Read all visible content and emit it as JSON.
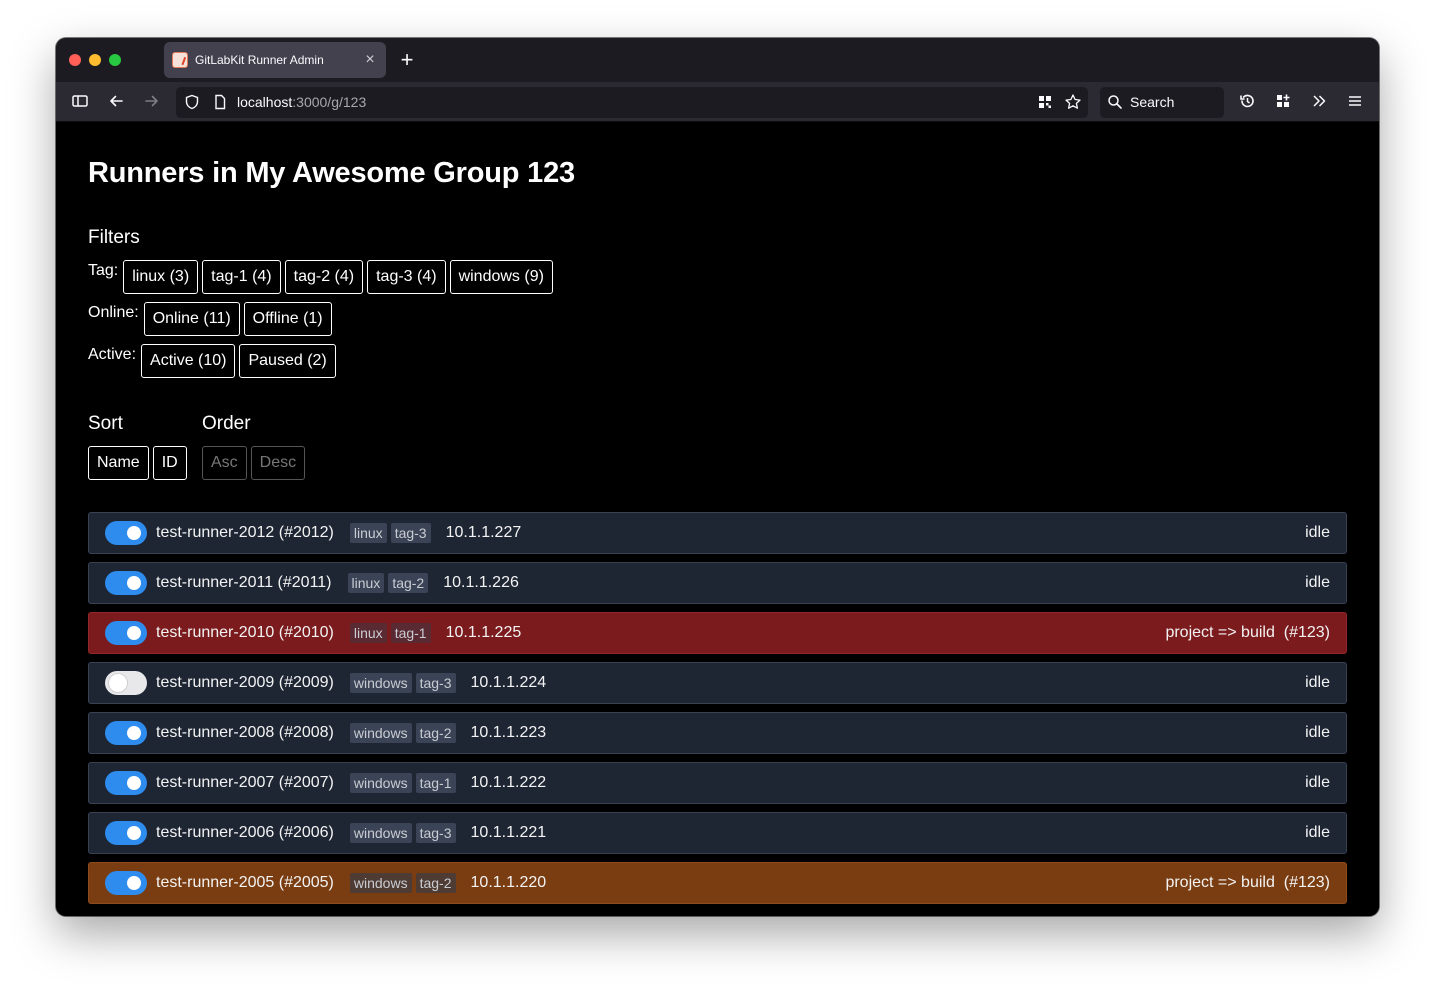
{
  "browser": {
    "tab_title": "GitLabKit Runner Admin",
    "new_tab": "+",
    "close": "×",
    "url_host": "localhost",
    "url_rest": ":3000/g/123",
    "search_placeholder": "Search"
  },
  "page": {
    "title": "Runners in My Awesome Group 123",
    "filters_title": "Filters",
    "filters": [
      {
        "label": "Tag:",
        "chips": [
          "linux (3)",
          "tag-1 (4)",
          "tag-2 (4)",
          "tag-3 (4)",
          "windows (9)"
        ]
      },
      {
        "label": "Online:",
        "chips": [
          "Online (11)",
          "Offline (1)"
        ]
      },
      {
        "label": "Active:",
        "chips": [
          "Active (10)",
          "Paused (2)"
        ]
      }
    ],
    "sort_title": "Sort",
    "sort_options": [
      "Name",
      "ID"
    ],
    "order_title": "Order",
    "order_options": [
      "Asc",
      "Desc"
    ]
  },
  "runners": [
    {
      "name": "test-runner-2012 (#2012)",
      "tags": [
        "linux",
        "tag-3"
      ],
      "ip": "10.1.1.227",
      "status": "idle",
      "active": true,
      "state": "idle"
    },
    {
      "name": "test-runner-2011 (#2011)",
      "tags": [
        "linux",
        "tag-2"
      ],
      "ip": "10.1.1.226",
      "status": "idle",
      "active": true,
      "state": "idle"
    },
    {
      "name": "test-runner-2010 (#2010)",
      "tags": [
        "linux",
        "tag-1"
      ],
      "ip": "10.1.1.225",
      "status": "project => build  (#123)",
      "active": true,
      "state": "busy-red"
    },
    {
      "name": "test-runner-2009 (#2009)",
      "tags": [
        "windows",
        "tag-3"
      ],
      "ip": "10.1.1.224",
      "status": "idle",
      "active": false,
      "state": "idle"
    },
    {
      "name": "test-runner-2008 (#2008)",
      "tags": [
        "windows",
        "tag-2"
      ],
      "ip": "10.1.1.223",
      "status": "idle",
      "active": true,
      "state": "idle"
    },
    {
      "name": "test-runner-2007 (#2007)",
      "tags": [
        "windows",
        "tag-1"
      ],
      "ip": "10.1.1.222",
      "status": "idle",
      "active": true,
      "state": "idle"
    },
    {
      "name": "test-runner-2006 (#2006)",
      "tags": [
        "windows",
        "tag-3"
      ],
      "ip": "10.1.1.221",
      "status": "idle",
      "active": true,
      "state": "idle"
    },
    {
      "name": "test-runner-2005 (#2005)",
      "tags": [
        "windows",
        "tag-2"
      ],
      "ip": "10.1.1.220",
      "status": "project => build  (#123)",
      "active": true,
      "state": "busy-orange"
    }
  ],
  "colors": {
    "toggle_on": "#2d8ced",
    "row_idle": "#1e2634",
    "row_busy_red": "#7b1b1d",
    "row_busy_orange": "#7a3d12"
  }
}
